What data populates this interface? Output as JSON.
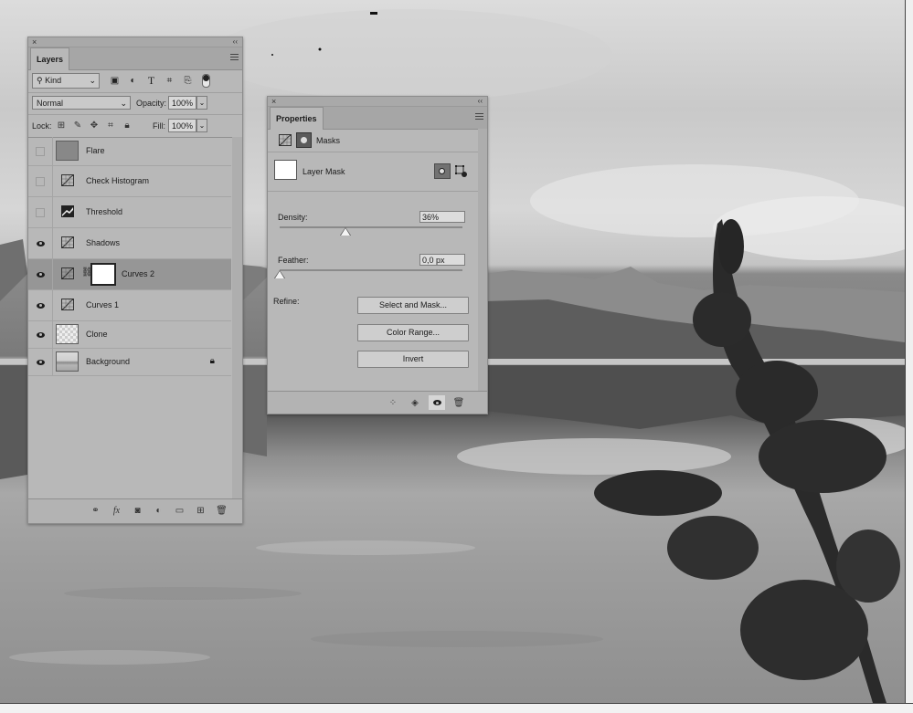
{
  "layers_panel": {
    "tab_title": "Layers",
    "filter_kind": "Kind",
    "blend_mode": "Normal",
    "opacity_label": "Opacity:",
    "opacity_value": "100%",
    "lock_label": "Lock:",
    "fill_label": "Fill:",
    "fill_value": "100%",
    "layers": [
      {
        "name": "Flare",
        "visible": false,
        "thumb": "gray-fill"
      },
      {
        "name": "Check Histogram",
        "visible": false,
        "thumb": "curves-icon"
      },
      {
        "name": "Threshold",
        "visible": false,
        "thumb": "threshold-icon"
      },
      {
        "name": "Shadows",
        "visible": true,
        "thumb": "curves-icon"
      },
      {
        "name": "Curves 2",
        "visible": true,
        "thumb": "curves-icon",
        "selected": true,
        "has_mask": true
      },
      {
        "name": "Curves 1",
        "visible": true,
        "thumb": "curves-icon"
      },
      {
        "name": "Clone",
        "visible": true,
        "thumb": "transparent"
      },
      {
        "name": "Background",
        "visible": true,
        "thumb": "photo",
        "locked": true
      }
    ]
  },
  "properties_panel": {
    "tab_title": "Properties",
    "section": "Masks",
    "mask_name": "Layer Mask",
    "density_label": "Density:",
    "density_value": "36%",
    "density_fraction": 0.36,
    "feather_label": "Feather:",
    "feather_value": "0,0 px",
    "feather_fraction": 0.0,
    "refine_label": "Refine:",
    "select_mask_button": "Select and Mask...",
    "color_range_button": "Color Range...",
    "invert_button": "Invert"
  },
  "colors": {
    "panel_bg": "#b8b8b8",
    "selected_row": "#969696"
  }
}
